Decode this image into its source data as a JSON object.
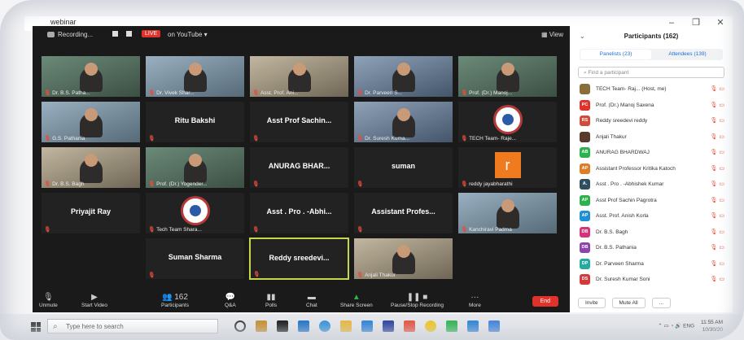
{
  "window": {
    "title": "webinar",
    "minimize": "–",
    "restore": "❐",
    "close": "✕"
  },
  "top": {
    "recording": "Recording...",
    "live": "LIVE",
    "youtube": "on YouTube ▾",
    "view": "View"
  },
  "tiles": [
    {
      "label": "Dr. B.S. Patha...",
      "kind": "video",
      "bg": "video"
    },
    {
      "label": "Dr. Vivek Shar...",
      "kind": "video",
      "bg": "video2"
    },
    {
      "label": "Asst. Prof. Ani...",
      "kind": "video",
      "bg": "video3"
    },
    {
      "label": "Dr. Parveen S...",
      "kind": "video",
      "bg": "video4"
    },
    {
      "label": "Prof. (Dr.) Manoj...",
      "kind": "video",
      "bg": "video"
    },
    {
      "label": "G.S. Pathania",
      "kind": "video",
      "bg": "video2"
    },
    {
      "label": "",
      "name": "Ritu Bakshi",
      "kind": "name"
    },
    {
      "label": "",
      "name": "Asst Prof Sachin...",
      "kind": "name"
    },
    {
      "label": "Dr. Suresh Kuma...",
      "kind": "video",
      "bg": "video4"
    },
    {
      "label": "TECH Team- Raje...",
      "kind": "logo"
    },
    {
      "label": "Dr. B.S. Bagh",
      "kind": "video",
      "bg": "video3"
    },
    {
      "label": "Prof. (Dr.) Yogender...",
      "kind": "video",
      "bg": "video"
    },
    {
      "label": "",
      "name": "ANURAG BHAR...",
      "kind": "name"
    },
    {
      "label": "",
      "name": "suman",
      "kind": "name"
    },
    {
      "label": "reddy jayabharathi",
      "kind": "orange",
      "letter": "r"
    },
    {
      "label": "",
      "name": "Priyajit Ray",
      "kind": "name"
    },
    {
      "label": "Tech Team Shara...",
      "kind": "logo"
    },
    {
      "label": "",
      "name": "Asst . Pro . -Abhi...",
      "kind": "name"
    },
    {
      "label": "",
      "name": "Assistant Profes...",
      "kind": "name"
    },
    {
      "label": "Kanchiravi Padma",
      "kind": "video",
      "bg": "video2"
    },
    {
      "label": "",
      "name": "Suman Sharma",
      "kind": "name"
    },
    {
      "label": "",
      "name": "Reddy sreedevi...",
      "kind": "name",
      "active": true
    },
    {
      "label": "Anjali Thakur",
      "kind": "video",
      "bg": "video3"
    }
  ],
  "toolbar": {
    "unmute": "Unmute",
    "start_video": "Start Video",
    "participants": "Participants",
    "participants_count": "162",
    "qa": "Q&A",
    "polls": "Polls",
    "chat": "Chat",
    "share": "Share Screen",
    "pause_rec": "Pause/Stop Recording",
    "more": "More",
    "end": "End"
  },
  "panel": {
    "title": "Participants (162)",
    "tab_panelists": "Panelists (23)",
    "tab_attendees": "Attendees (139)",
    "search_placeholder": "Find a participant",
    "invite": "Invite",
    "mute_all": "Mute All",
    "more": "...",
    "rows": [
      {
        "initials": "",
        "name": "TECH Team- Raj... (Host, me)",
        "color": "#8a6d3b"
      },
      {
        "initials": "PC",
        "name": "Prof. (Dr.) Manoj Saxena",
        "color": "#e0312b"
      },
      {
        "initials": "RS",
        "name": "Reddy sreedevi reddy",
        "color": "#d24a3c"
      },
      {
        "initials": "",
        "name": "Anjali Thakur",
        "color": "#5a3a2a"
      },
      {
        "initials": "AB",
        "name": "ANURAG BHARDWAJ",
        "color": "#2bb24c"
      },
      {
        "initials": "AP",
        "name": "Assistant Professor Kritika Katoch",
        "color": "#e07b26"
      },
      {
        "initials": "A.",
        "name": "Asst . Pro . -Abhishek Kumar",
        "color": "#2f4f5f"
      },
      {
        "initials": "AP",
        "name": "Asst Prof Sachin Pagrotra",
        "color": "#2bb24c"
      },
      {
        "initials": "AP",
        "name": "Asst. Prof. Anish Korla",
        "color": "#1f8fd6"
      },
      {
        "initials": "DB",
        "name": "Dr. B.S. Bagh",
        "color": "#d4347a"
      },
      {
        "initials": "DB",
        "name": "Dr. B.S. Pathania",
        "color": "#8e44ad"
      },
      {
        "initials": "DP",
        "name": "Dr. Parveen Sharma",
        "color": "#27a8a0"
      },
      {
        "initials": "DS",
        "name": "Dr. Suresh Kumar Soni",
        "color": "#d23a3a"
      }
    ]
  },
  "taskbar": {
    "search_placeholder": "Type here to search",
    "lang": "ENG",
    "time": "11:55 AM",
    "date": "10/30/20"
  }
}
